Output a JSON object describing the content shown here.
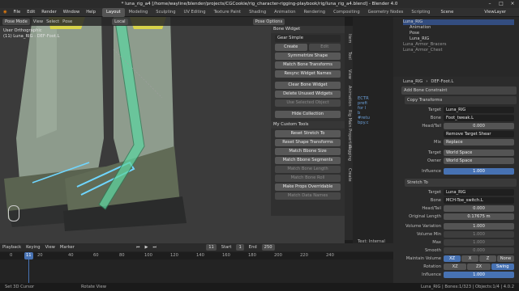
{
  "window": {
    "title": "* luna_rig_a4 [/home/wayline/blender/projects/CGCookie/rig_character-rigging-playbook/rig/luna_rig_a4.blend] - Blender 4.0"
  },
  "menu": {
    "items": [
      "File",
      "Edit",
      "Render",
      "Window",
      "Help"
    ],
    "workspaces": [
      "Layout",
      "Modeling",
      "Sculpting",
      "UV Editing",
      "Texture Paint",
      "Shading",
      "Animation",
      "Rendering",
      "Compositing",
      "Geometry Nodes",
      "Scripting"
    ],
    "scene": "Scene",
    "view_layer": "ViewLayer"
  },
  "viewport": {
    "mode": "Pose Mode",
    "menus": [
      "View",
      "Select",
      "Pose"
    ],
    "orientation": "Local",
    "pose_options": "Pose Options",
    "info_line1": "User Orthographic",
    "info_line2": "(11) Luna_RIG : DEF-Foot.L"
  },
  "npanel": {
    "bone_widget": "Bone Widget",
    "shape": "Gear Simple",
    "create": "Create",
    "edit": "Edit",
    "buttons": [
      "Symmetrize Shape",
      "Match Bone Transforms",
      "Resync Widget Names",
      "Clear Bone Widget",
      "Delete Unused Widgets",
      "Use Selected Object",
      "Hide Collection"
    ],
    "custom_tools": "My Custom Tools",
    "tools": [
      "Reset Stretch To",
      "Reset Shape Transforms",
      "Match Bbone Size",
      "Match Bbone Segments",
      "Match Bone Length",
      "Match Bone Roll",
      "Make Props Overridable",
      "Match Data Names"
    ],
    "tabs": [
      "Item",
      "Tool",
      "View",
      "Animation",
      "Rig Main Properties",
      "Rigging",
      "Create",
      "Text: Internal"
    ]
  },
  "outliner": {
    "rows": [
      "Luna_RIG",
      "Animation",
      "Pose",
      "Luna_RIG",
      "Luna_Armor_Bracers",
      "Luna_Armor_Chest"
    ]
  },
  "properties": {
    "breadcrumb_obj": "Luna_RIG",
    "breadcrumb_bone": "DEF-Foot.L",
    "add_constraint": "Add Bone Constraint",
    "c1": {
      "name": "Copy Transforms",
      "target_label": "Target",
      "target": "Luna_RIG",
      "bone_label": "Bone",
      "bone": "Foot_tweak.L",
      "headtail_label": "Head/Tail",
      "headtail": "0.000",
      "remove_shear": "Remove Target Shear",
      "mix_label": "Mix",
      "mix": "Replace",
      "target_space_label": "Target",
      "target_space": "World Space",
      "owner_space_label": "Owner",
      "owner_space": "World Space",
      "influence_label": "Influence",
      "influence": "1.000"
    },
    "c2": {
      "name": "Stretch To",
      "target_label": "Target",
      "target": "Luna_RIG",
      "bone_label": "Bone",
      "bone": "MCH-Toe_switch.L",
      "headtail_label": "Head/Tail",
      "headtail": "0.000",
      "length_label": "Original Length",
      "length": "0.17675 m",
      "volvar_label": "Volume Variation",
      "volvar": "1.000",
      "volmin_label": "Volume Min",
      "volmin": "1.000",
      "volmax_label": "Max",
      "volmax": "1.000",
      "smooth_label": "Smooth",
      "smooth": "0.000",
      "maintain_label": "Maintain Volume",
      "maintain": [
        "XZ",
        "X",
        "Z",
        "None"
      ],
      "rotation_label": "Rotation",
      "rotation": [
        "XZ",
        "ZX",
        "Swing"
      ],
      "influence_label": "Influence",
      "influence": "1.000"
    }
  },
  "code": {
    "lines": [
      "ECTR",
      "prefi",
      "for l",
      "b",
      "",
      "#retu",
      "bpy.c"
    ]
  },
  "timeline": {
    "menus": [
      "Playback",
      "Keying",
      "View",
      "Marker"
    ],
    "frame": "11",
    "start_label": "Start",
    "start": "1",
    "end_label": "End",
    "end": "250",
    "ticks": [
      "0",
      "20",
      "40",
      "60",
      "80",
      "100",
      "120",
      "140",
      "160",
      "180",
      "200",
      "220",
      "240"
    ],
    "current": "11"
  },
  "status": {
    "left": "Set 3D Cursor",
    "mid": "Rotate View",
    "right": "Luna_RIG | Bones:1/323 | Objects:1/4 | 4.0.2"
  },
  "colors": {
    "accent": "#4772b3",
    "active_bone": "#5fd3a0",
    "widget": "#6fd6ff"
  }
}
